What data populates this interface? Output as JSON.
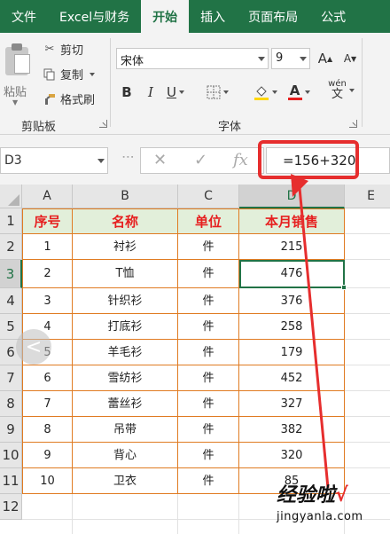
{
  "tabs": [
    "文件",
    "Excel与财务",
    "开始",
    "插入",
    "页面布局",
    "公式"
  ],
  "active_tab": "开始",
  "clipboard": {
    "paste_label": "粘贴",
    "cut_label": "剪切",
    "copy_label": "复制",
    "format_painter_label": "格式刷",
    "group_label": "剪贴板"
  },
  "font": {
    "name": "宋体",
    "size": "9",
    "group_label": "字体",
    "bold": "B",
    "italic": "I",
    "underline": "U",
    "grow": "A",
    "shrink": "A",
    "font_color": "A",
    "phonetic": "wén"
  },
  "formula_bar": {
    "name_box": "D3",
    "cancel": "✕",
    "enter": "✓",
    "fx": "fx",
    "formula": "=156+320"
  },
  "sheet": {
    "columns": [
      "A",
      "B",
      "C",
      "D",
      "E"
    ],
    "rows": [
      "1",
      "2",
      "3",
      "4",
      "5",
      "6",
      "7",
      "8",
      "9",
      "10",
      "11",
      "12"
    ],
    "selected_cell": "D3",
    "header": [
      "序号",
      "名称",
      "单位",
      "本月销售"
    ],
    "data": [
      [
        "1",
        "衬衫",
        "件",
        "215"
      ],
      [
        "2",
        "T恤",
        "件",
        "476"
      ],
      [
        "3",
        "针织衫",
        "件",
        "376"
      ],
      [
        "4",
        "打底衫",
        "件",
        "258"
      ],
      [
        "5",
        "羊毛衫",
        "件",
        "179"
      ],
      [
        "6",
        "雪纺衫",
        "件",
        "452"
      ],
      [
        "7",
        "蕾丝衫",
        "件",
        "327"
      ],
      [
        "8",
        "吊带",
        "件",
        "382"
      ],
      [
        "9",
        "背心",
        "件",
        "320"
      ],
      [
        "10",
        "卫衣",
        "件",
        "85"
      ]
    ]
  },
  "watermark": {
    "main": "经验啦",
    "check": "√",
    "sub": "jingyanla.com"
  },
  "colors": {
    "ribbon_green": "#217346",
    "header_fill": "#e2efda",
    "header_text": "#e62020",
    "cell_border": "#e07b22",
    "annotation_red": "#e62e2e"
  }
}
